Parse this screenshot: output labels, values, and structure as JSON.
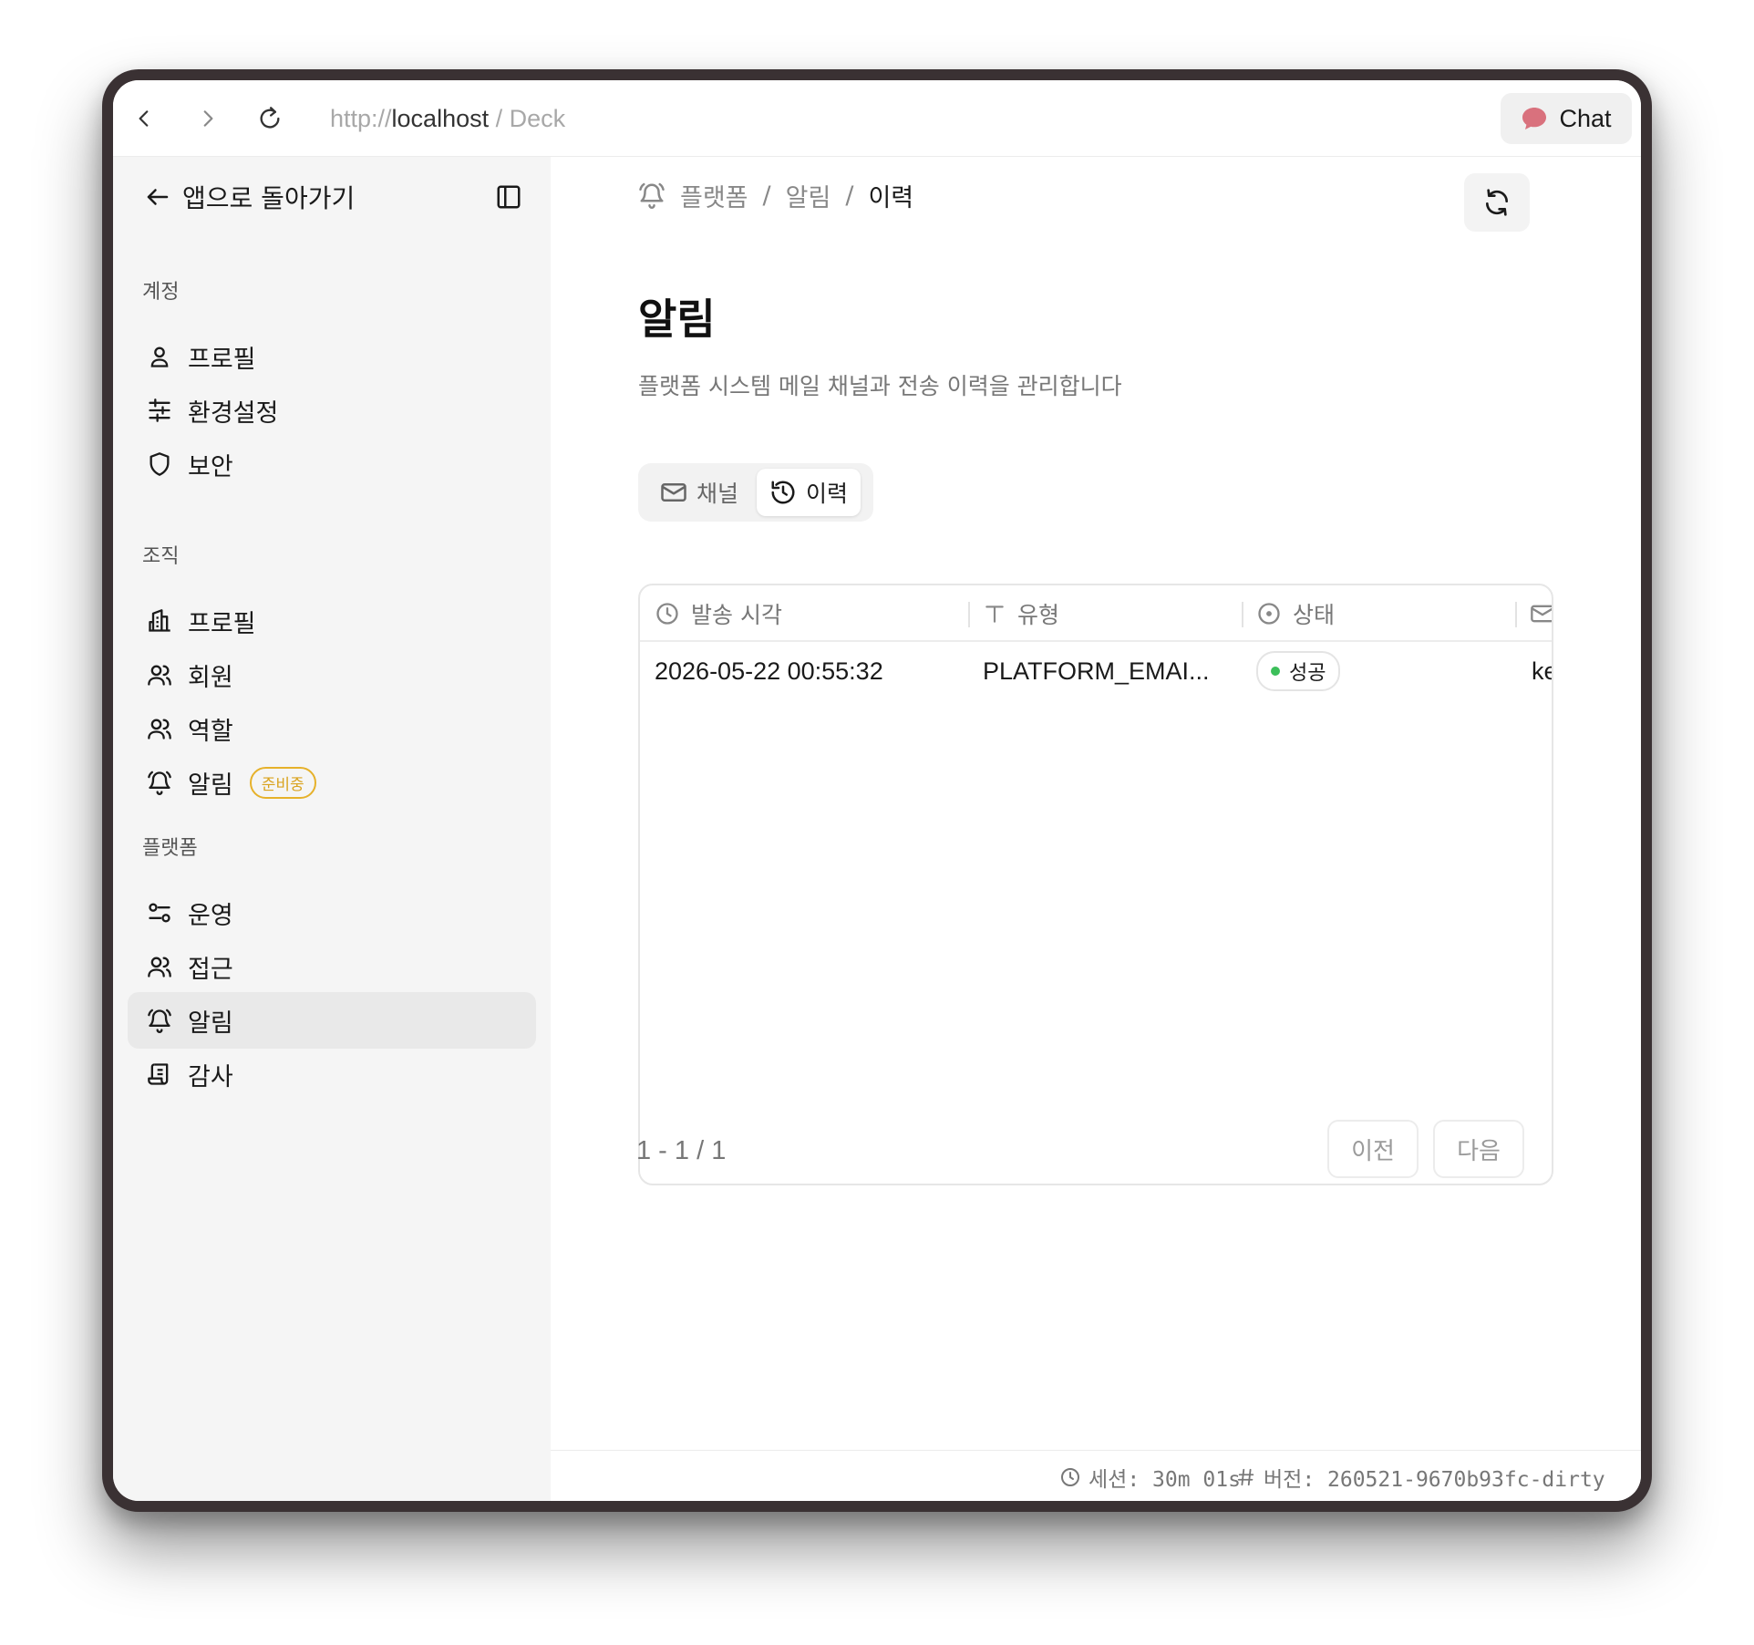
{
  "browser": {
    "url_scheme": "http://",
    "url_host": "localhost",
    "url_suffix": " / Deck",
    "chat_label": "Chat",
    "chat_icon_color": "#d9717d"
  },
  "sidebar": {
    "back_label": "앱으로 돌아가기",
    "sections": [
      {
        "label": "계정",
        "items": [
          {
            "label": "프로필",
            "icon": "user-icon"
          },
          {
            "label": "환경설정",
            "icon": "sliders-icon"
          },
          {
            "label": "보안",
            "icon": "shield-icon"
          }
        ]
      },
      {
        "label": "조직",
        "items": [
          {
            "label": "프로필",
            "icon": "building-icon"
          },
          {
            "label": "회원",
            "icon": "users-icon"
          },
          {
            "label": "역할",
            "icon": "users-icon"
          },
          {
            "label": "알림",
            "icon": "bell-icon",
            "badge": "준비중"
          }
        ]
      },
      {
        "label": "플랫폼",
        "items": [
          {
            "label": "운영",
            "icon": "toggles-icon"
          },
          {
            "label": "접근",
            "icon": "users-icon"
          },
          {
            "label": "알림",
            "icon": "bell-icon",
            "active": true
          },
          {
            "label": "감사",
            "icon": "scroll-icon"
          }
        ]
      }
    ]
  },
  "breadcrumb": {
    "items": [
      "플랫폼",
      "알림",
      "이력"
    ],
    "separator": "/"
  },
  "page": {
    "title": "알림",
    "description": "플랫폼 시스템 메일 채널과 전송 이력을 관리합니다"
  },
  "tabs": [
    {
      "label": "채널",
      "icon": "mail-icon"
    },
    {
      "label": "이력",
      "icon": "history-icon",
      "selected": true
    }
  ],
  "table": {
    "columns": [
      {
        "label": "발송 시각",
        "icon": "clock-icon"
      },
      {
        "label": "유형",
        "icon": "text-type-icon"
      },
      {
        "label": "상태",
        "icon": "circle-dot-icon"
      },
      {
        "label": "",
        "icon": "mail-icon"
      }
    ],
    "rows": [
      {
        "sent_at": "2026-05-22 00:55:32",
        "type": "PLATFORM_EMAI...",
        "status": "성공",
        "recipient": "ke"
      }
    ]
  },
  "pagination": {
    "range": "1 - 1 / 1",
    "prev_label": "이전",
    "next_label": "다음"
  },
  "footer": {
    "session": "세션: 30m 01s",
    "version": "버전: 260521-9670b93fc-dirty"
  },
  "colors": {
    "accent_badge": "#e6b12a",
    "status_success": "#3cbf5a",
    "sidebar_bg": "#f5f5f5"
  }
}
